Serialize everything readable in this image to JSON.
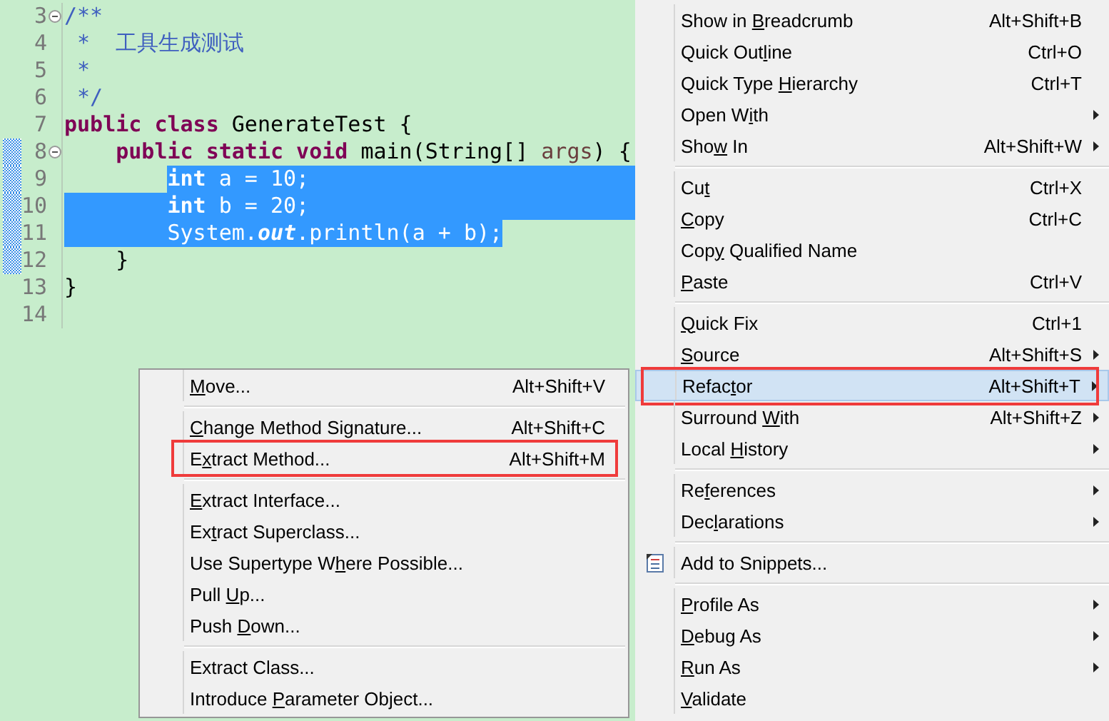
{
  "editor": {
    "lines": [
      {
        "number": "3",
        "kind": "top",
        "fold_marker": true,
        "changed": false,
        "selection_to_edge": false,
        "tokens": [
          {
            "kind": "comment",
            "text": "/**",
            "selected": false
          }
        ]
      },
      {
        "number": "4",
        "kind": "top",
        "fold_marker": false,
        "changed": false,
        "selection_to_edge": false,
        "tokens": [
          {
            "kind": "comment",
            "text": " *  工具生成测试",
            "selected": false
          }
        ]
      },
      {
        "number": "5",
        "kind": "top",
        "fold_marker": false,
        "changed": false,
        "selection_to_edge": false,
        "tokens": [
          {
            "kind": "comment",
            "text": " *",
            "selected": false
          }
        ]
      },
      {
        "number": "6",
        "kind": "top",
        "fold_marker": false,
        "changed": false,
        "selection_to_edge": false,
        "tokens": [
          {
            "kind": "comment",
            "text": " */",
            "selected": false
          }
        ]
      },
      {
        "number": "7",
        "kind": "top",
        "fold_marker": false,
        "changed": false,
        "selection_to_edge": false,
        "tokens": [
          {
            "kind": "keyword",
            "text": "public",
            "selected": false
          },
          {
            "kind": "keyword",
            "text": " class",
            "selected": false
          },
          {
            "kind": "plain",
            "text": " GenerateTest {",
            "selected": false
          }
        ]
      },
      {
        "number": "8",
        "kind": "member",
        "fold_marker": true,
        "changed": true,
        "selection_to_edge": false,
        "indent_selected": false,
        "tokens": [
          {
            "kind": "keyword",
            "text": "public",
            "selected": false
          },
          {
            "kind": "keyword",
            "text": " static",
            "selected": false
          },
          {
            "kind": "keyword",
            "text": " void",
            "selected": false
          },
          {
            "kind": "plain",
            "text": " main(String[] ",
            "selected": false
          },
          {
            "kind": "param",
            "text": "args",
            "selected": false
          },
          {
            "kind": "plain",
            "text": ") {",
            "selected": false
          }
        ]
      },
      {
        "number": "9",
        "kind": "statement",
        "fold_marker": false,
        "changed": true,
        "selection_to_edge": true,
        "indent_selected": false,
        "tokens": [
          {
            "kind": "keyword",
            "text": "int",
            "selected": true
          },
          {
            "kind": "plain",
            "text": " a = 10;",
            "selected": true
          }
        ]
      },
      {
        "number": "10",
        "kind": "statement",
        "fold_marker": false,
        "changed": true,
        "selection_to_edge": true,
        "indent_selected": true,
        "tokens": [
          {
            "kind": "keyword",
            "text": "int",
            "selected": true
          },
          {
            "kind": "plain",
            "text": " b = 20;",
            "selected": true
          }
        ]
      },
      {
        "number": "11",
        "kind": "statement",
        "fold_marker": false,
        "changed": true,
        "selection_to_edge": false,
        "indent_selected": true,
        "tokens": [
          {
            "kind": "plain",
            "text": "System.",
            "selected": true
          },
          {
            "kind": "field",
            "text": "out",
            "selected": true
          },
          {
            "kind": "plain",
            "text": ".println(a + b);",
            "selected": true
          }
        ]
      },
      {
        "number": "12",
        "kind": "member",
        "fold_marker": false,
        "changed": true,
        "selection_to_edge": false,
        "indent_selected": false,
        "tokens": [
          {
            "kind": "plain",
            "text": "}",
            "selected": false
          }
        ]
      },
      {
        "number": "13",
        "kind": "top",
        "fold_marker": false,
        "changed": false,
        "selection_to_edge": false,
        "tokens": [
          {
            "kind": "plain",
            "text": "}",
            "selected": false
          }
        ]
      },
      {
        "number": "14",
        "fold_marker": false,
        "changed": false,
        "selection_to_edge": false
      }
    ]
  },
  "context_menu": {
    "items": [
      {
        "kind": "item",
        "label": {
          "before": "Show in ",
          "key": "B",
          "after": "readcrumb"
        },
        "shortcut": "Alt+Shift+B",
        "submenu": false,
        "selected": false,
        "outlined": false
      },
      {
        "kind": "item",
        "label": {
          "before": "Quick Out",
          "key": "l",
          "after": "ine"
        },
        "shortcut": "Ctrl+O",
        "submenu": false,
        "selected": false,
        "outlined": false
      },
      {
        "kind": "item",
        "label": {
          "before": "Quick Type ",
          "key": "H",
          "after": "ierarchy"
        },
        "shortcut": "Ctrl+T",
        "submenu": false,
        "selected": false,
        "outlined": false
      },
      {
        "kind": "item",
        "label": {
          "before": "Open W",
          "key": "i",
          "after": "th"
        },
        "submenu": true,
        "selected": false,
        "outlined": false
      },
      {
        "kind": "item",
        "label": {
          "before": "Sho",
          "key": "w",
          "after": " In"
        },
        "shortcut": "Alt+Shift+W",
        "submenu": true,
        "selected": false,
        "outlined": false
      },
      {
        "kind": "separator"
      },
      {
        "kind": "item",
        "label": {
          "before": "Cu",
          "key": "t"
        },
        "shortcut": "Ctrl+X",
        "submenu": false,
        "selected": false,
        "outlined": false
      },
      {
        "kind": "item",
        "label": {
          "key": "C",
          "after": "opy"
        },
        "shortcut": "Ctrl+C",
        "submenu": false,
        "selected": false,
        "outlined": false
      },
      {
        "kind": "item",
        "label": {
          "before": "Cop",
          "key": "y",
          "after": " Qualified Name"
        },
        "submenu": false,
        "selected": false,
        "outlined": false
      },
      {
        "kind": "item",
        "label": {
          "key": "P",
          "after": "aste"
        },
        "shortcut": "Ctrl+V",
        "submenu": false,
        "selected": false,
        "outlined": false
      },
      {
        "kind": "separator"
      },
      {
        "kind": "item",
        "label": {
          "key": "Q",
          "after": "uick Fix"
        },
        "shortcut": "Ctrl+1",
        "submenu": false,
        "selected": false,
        "outlined": false
      },
      {
        "kind": "item",
        "label": {
          "key": "S",
          "after": "ource"
        },
        "shortcut": "Alt+Shift+S",
        "submenu": true,
        "selected": false,
        "outlined": false
      },
      {
        "kind": "item",
        "label": {
          "before": "Refac",
          "key": "t",
          "after": "or"
        },
        "shortcut": "Alt+Shift+T",
        "submenu": true,
        "selected": true,
        "outlined": true
      },
      {
        "kind": "item",
        "label": {
          "before": "Surround ",
          "key": "W",
          "after": "ith"
        },
        "shortcut": "Alt+Shift+Z",
        "submenu": true,
        "selected": false,
        "outlined": false
      },
      {
        "kind": "item",
        "label": {
          "before": "Local ",
          "key": "H",
          "after": "istory"
        },
        "submenu": true,
        "selected": false,
        "outlined": false
      },
      {
        "kind": "separator"
      },
      {
        "kind": "item",
        "label": {
          "before": "Re",
          "key": "f",
          "after": "erences"
        },
        "submenu": true,
        "selected": false,
        "outlined": false
      },
      {
        "kind": "item",
        "label": {
          "before": "Dec",
          "key": "l",
          "after": "arations"
        },
        "submenu": true,
        "selected": false,
        "outlined": false
      },
      {
        "kind": "separator"
      },
      {
        "kind": "item",
        "label": {
          "before": "Add to Snippets..."
        },
        "icon": true,
        "submenu": false,
        "selected": false,
        "outlined": false
      },
      {
        "kind": "separator"
      },
      {
        "kind": "item",
        "label": {
          "key": "P",
          "after": "rofile As"
        },
        "submenu": true,
        "selected": false,
        "outlined": false
      },
      {
        "kind": "item",
        "label": {
          "key": "D",
          "after": "ebug As"
        },
        "submenu": true,
        "selected": false,
        "outlined": false
      },
      {
        "kind": "item",
        "label": {
          "key": "R",
          "after": "un As"
        },
        "submenu": true,
        "selected": false,
        "outlined": false
      },
      {
        "kind": "item",
        "label": {
          "key": "V",
          "after": "alidate"
        },
        "submenu": false,
        "selected": false,
        "outlined": false
      }
    ]
  },
  "refactor_submenu": {
    "items": [
      {
        "kind": "item",
        "label": {
          "key": "M",
          "after": "ove..."
        },
        "shortcut": "Alt+Shift+V",
        "selected": false,
        "outlined": false
      },
      {
        "kind": "separator"
      },
      {
        "kind": "item",
        "label": {
          "key": "C",
          "after": "hange Method Signature..."
        },
        "shortcut": "Alt+Shift+C",
        "selected": false,
        "outlined": false
      },
      {
        "kind": "item",
        "label": {
          "before": "E",
          "key": "x",
          "after": "tract Method..."
        },
        "shortcut": "Alt+Shift+M",
        "selected": false,
        "outlined": true
      },
      {
        "kind": "separator"
      },
      {
        "kind": "item",
        "label": {
          "key": "E",
          "after": "xtract Interface..."
        },
        "selected": false,
        "outlined": false
      },
      {
        "kind": "item",
        "label": {
          "before": "Ex",
          "key": "t",
          "after": "ract Superclass..."
        },
        "selected": false,
        "outlined": false
      },
      {
        "kind": "item",
        "label": {
          "before": "Use Supertype W",
          "key": "h",
          "after": "ere Possible..."
        },
        "selected": false,
        "outlined": false
      },
      {
        "kind": "item",
        "label": {
          "before": "Pull ",
          "key": "U",
          "after": "p..."
        },
        "selected": false,
        "outlined": false
      },
      {
        "kind": "item",
        "label": {
          "before": "Push ",
          "key": "D",
          "after": "own..."
        },
        "selected": false,
        "outlined": false
      },
      {
        "kind": "separator"
      },
      {
        "kind": "item",
        "label": {
          "before": "Extract Class..."
        },
        "selected": false,
        "outlined": false
      },
      {
        "kind": "item",
        "label": {
          "before": "Introduce ",
          "key": "P",
          "after": "arameter Object..."
        },
        "selected": false,
        "outlined": false
      }
    ]
  }
}
